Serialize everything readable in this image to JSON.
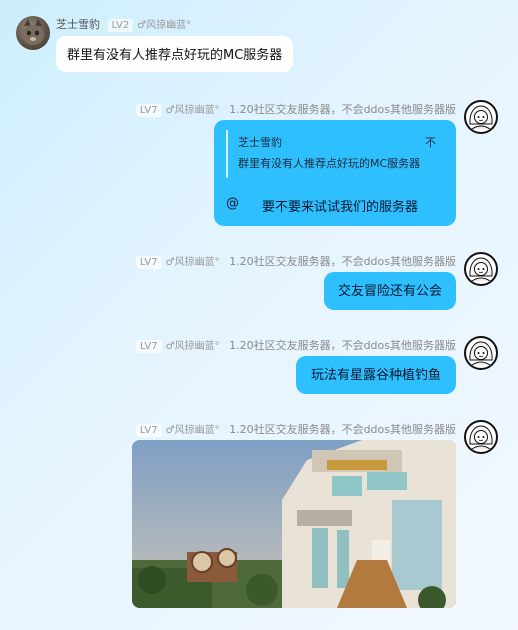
{
  "messages": [
    {
      "sender": "芝士雪豹",
      "level": "LV2",
      "group_tag": "♂风掠幽蓝°",
      "text": "群里有没有人推荐点好玩的MC服务器"
    },
    {
      "sender_level": "LV7",
      "sender_group_tag": "♂风掠幽蓝°",
      "sender_title": "1.20社区交友服务器，不会ddos其他服务器版",
      "quote": {
        "author": "芝士雪豹",
        "more_label": "不",
        "text": "群里有没有人推荐点好玩的MC服务器"
      },
      "at_symbol": "@",
      "reply": "要不要来试试我们的服务器"
    },
    {
      "sender_level": "LV7",
      "sender_group_tag": "♂风掠幽蓝°",
      "sender_title": "1.20社区交友服务器，不会ddos其他服务器版",
      "text": "交友冒险还有公会"
    },
    {
      "sender_level": "LV7",
      "sender_group_tag": "♂风掠幽蓝°",
      "sender_title": "1.20社区交友服务器，不会ddos其他服务器版",
      "text": "玩法有星露谷种植钓鱼"
    },
    {
      "sender_level": "LV7",
      "sender_group_tag": "♂风掠幽蓝°",
      "sender_title": "1.20社区交友服务器，不会ddos其他服务器版",
      "image": "minecraft-building-screenshot"
    }
  ],
  "colors": {
    "self_bubble": "#2ebfff",
    "other_bubble": "#ffffff",
    "background": "#d9f1ff"
  },
  "icons": {
    "left_avatar": "cat-avatar",
    "right_avatar": "anime-girl-avatar"
  }
}
